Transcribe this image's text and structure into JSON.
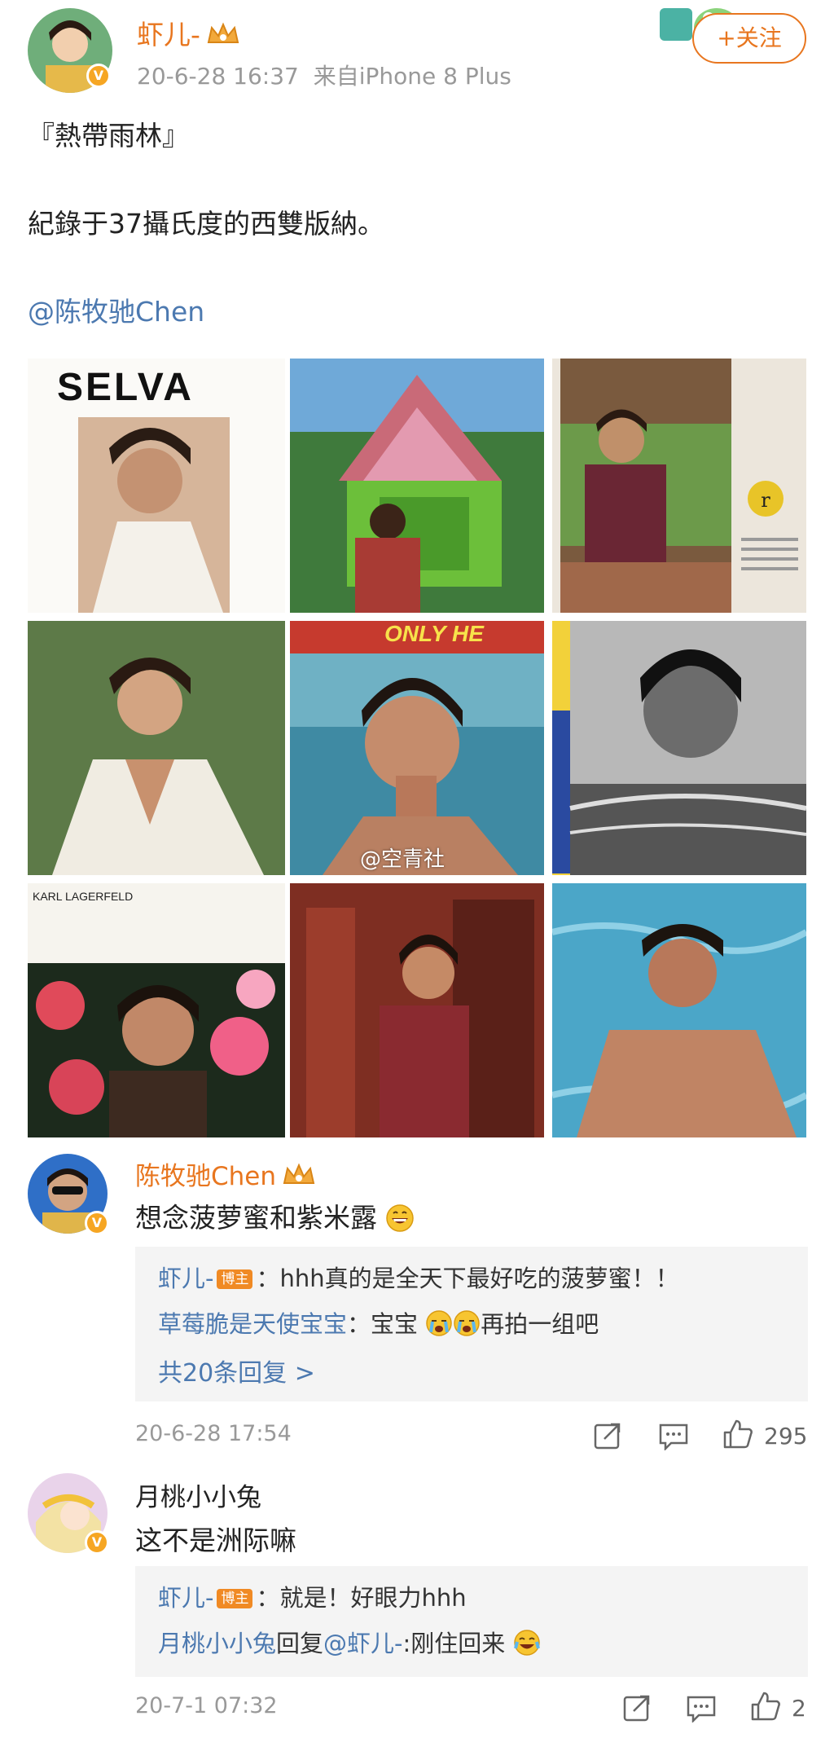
{
  "post": {
    "author": "虾儿-",
    "timestamp": "20-6-28 16:37",
    "source": "来自iPhone 8 Plus",
    "follow_label": "+关注",
    "title_line": "『熱帶雨林』",
    "body_line": "紀錄于37攝氏度的西雙版納。",
    "mention": "@陈牧驰Chen",
    "images": [
      {
        "caption": "SELVA"
      },
      {
        "caption": ""
      },
      {
        "caption": ""
      },
      {
        "caption": ""
      },
      {
        "caption": "ONLY HE",
        "watermark": "@空青社"
      },
      {
        "caption": ""
      },
      {
        "caption": "KARL LAGERFELD"
      },
      {
        "caption": ""
      },
      {
        "caption": ""
      }
    ]
  },
  "comments": [
    {
      "author": "陈牧驰Chen",
      "text": "想念菠萝蜜和紫米露",
      "replies": [
        {
          "name": "虾儿-",
          "tag": "博主",
          "text": "：hhh真的是全天下最好吃的菠萝蜜！！"
        },
        {
          "name": "草莓脆是天使宝宝",
          "text": "：宝宝",
          "text2": "再拍一组吧"
        }
      ],
      "more_replies": "共20条回复 >",
      "date": "20-6-28 17:54",
      "likes": "295"
    },
    {
      "author": "月桃小小兔",
      "text": "这不是洲际嘛",
      "replies": [
        {
          "name": "虾儿-",
          "tag": "博主",
          "text": "：就是！好眼力hhh"
        },
        {
          "name": "月桃小小兔",
          "text": "回复",
          "mention": "@虾儿-",
          "text2": ":刚住回来"
        }
      ],
      "date": "20-7-1 07:32",
      "likes": "2"
    }
  ],
  "colors": {
    "accent": "#e8761f",
    "link": "#4c79b0",
    "muted": "#999999"
  }
}
